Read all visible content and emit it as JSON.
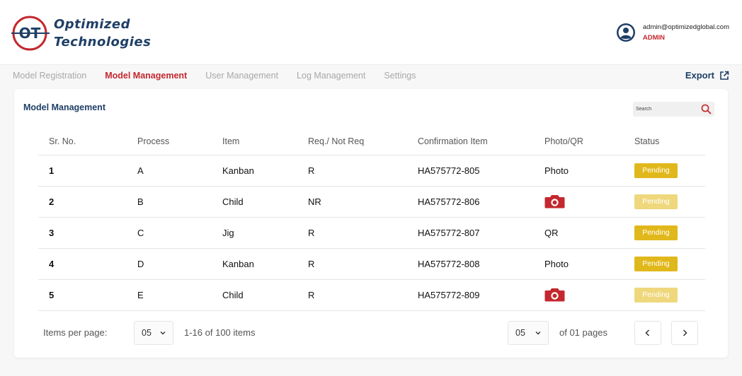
{
  "brand": {
    "line1": "Optimized",
    "line2": "Technologies",
    "logo_letters": "OT"
  },
  "user": {
    "email": "admin@optimizedglobal.com",
    "role": "ADMIN"
  },
  "nav": {
    "tabs": [
      {
        "label": "Model Registration",
        "active": false
      },
      {
        "label": "Model Management",
        "active": true
      },
      {
        "label": "User Management",
        "active": false
      },
      {
        "label": "Log Management",
        "active": false
      },
      {
        "label": "Settings",
        "active": false
      }
    ],
    "export_label": "Export"
  },
  "card": {
    "title": "Model Management"
  },
  "search": {
    "placeholder": "Search"
  },
  "table": {
    "headers": [
      "Sr. No.",
      "Process",
      "Item",
      "Req./ Not Req",
      "Confirmation Item",
      "Photo/QR",
      "Status"
    ],
    "rows": [
      {
        "sr": "1",
        "process": "A",
        "item": "Kanban",
        "req": "R",
        "confirmation": "HA575772-805",
        "photo_qr": "Photo",
        "photo_icon": false,
        "status": "Pending",
        "status_faded": false
      },
      {
        "sr": "2",
        "process": "B",
        "item": "Child",
        "req": "NR",
        "confirmation": "HA575772-806",
        "photo_qr": "",
        "photo_icon": true,
        "status": "Pending",
        "status_faded": true
      },
      {
        "sr": "3",
        "process": "C",
        "item": "Jig",
        "req": "R",
        "confirmation": "HA575772-807",
        "photo_qr": "QR",
        "photo_icon": false,
        "status": "Pending",
        "status_faded": false
      },
      {
        "sr": "4",
        "process": "D",
        "item": "Kanban",
        "req": "R",
        "confirmation": "HA575772-808",
        "photo_qr": "Photo",
        "photo_icon": false,
        "status": "Pending",
        "status_faded": false
      },
      {
        "sr": "5",
        "process": "E",
        "item": "Child",
        "req": "R",
        "confirmation": "HA575772-809",
        "photo_qr": "",
        "photo_icon": true,
        "status": "Pending",
        "status_faded": true
      }
    ]
  },
  "pagination": {
    "items_per_page_label": "Items per page:",
    "items_per_page_value": "05",
    "range_text": "1-16 of 100 items",
    "page_value": "05",
    "pages_text": "of 01 pages"
  },
  "colors": {
    "brand_red": "#c3282e",
    "brand_navy": "#1f3f66",
    "pending": "#e1b81b",
    "pending_faded": "#efd77c"
  },
  "icons": {
    "camera": "camera-icon",
    "search": "search-icon",
    "user": "user-avatar-icon",
    "export": "external-link-icon"
  }
}
